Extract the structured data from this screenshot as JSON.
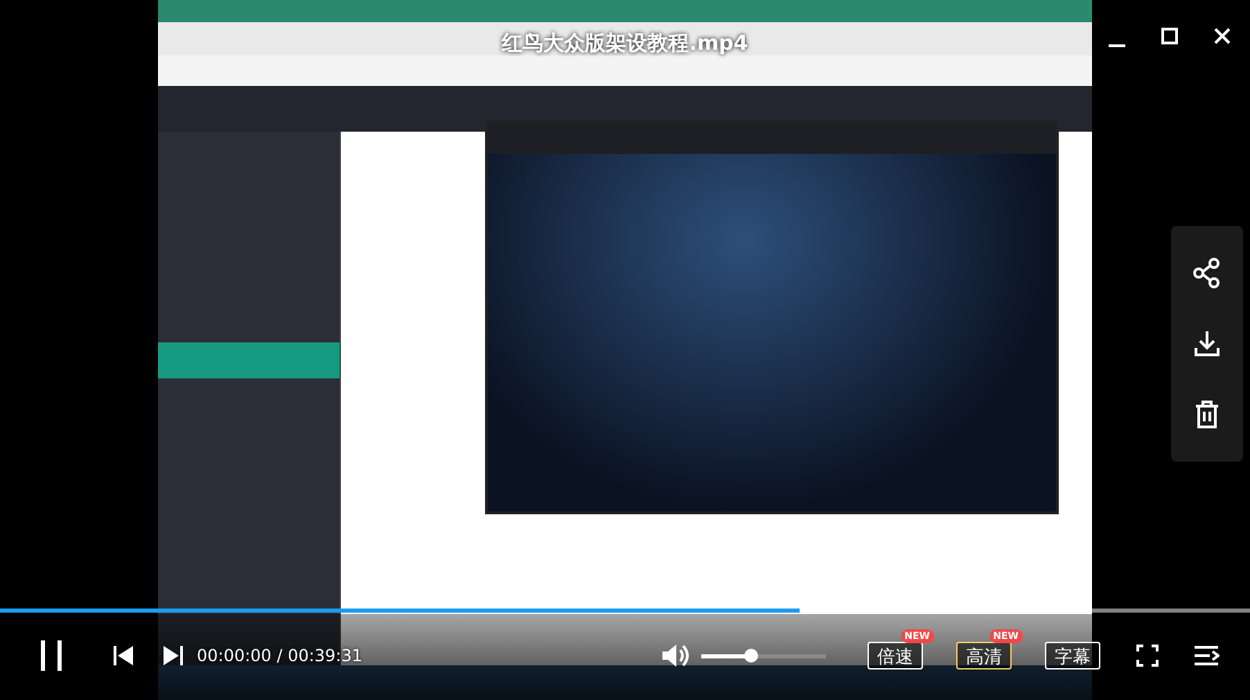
{
  "player": {
    "title": "红鸟大众版架设教程.mp4"
  },
  "progress": {
    "level": 0.64
  },
  "controls": {
    "time": "00:00:00 / 00:39:31",
    "volume": {
      "level": 0.4
    },
    "buttons": [
      {
        "label": "倍速",
        "badge": "NEW",
        "selected": false
      },
      {
        "label": "高清",
        "badge": "NEW",
        "selected": true
      },
      {
        "label": "字幕",
        "selected": false
      }
    ]
  }
}
